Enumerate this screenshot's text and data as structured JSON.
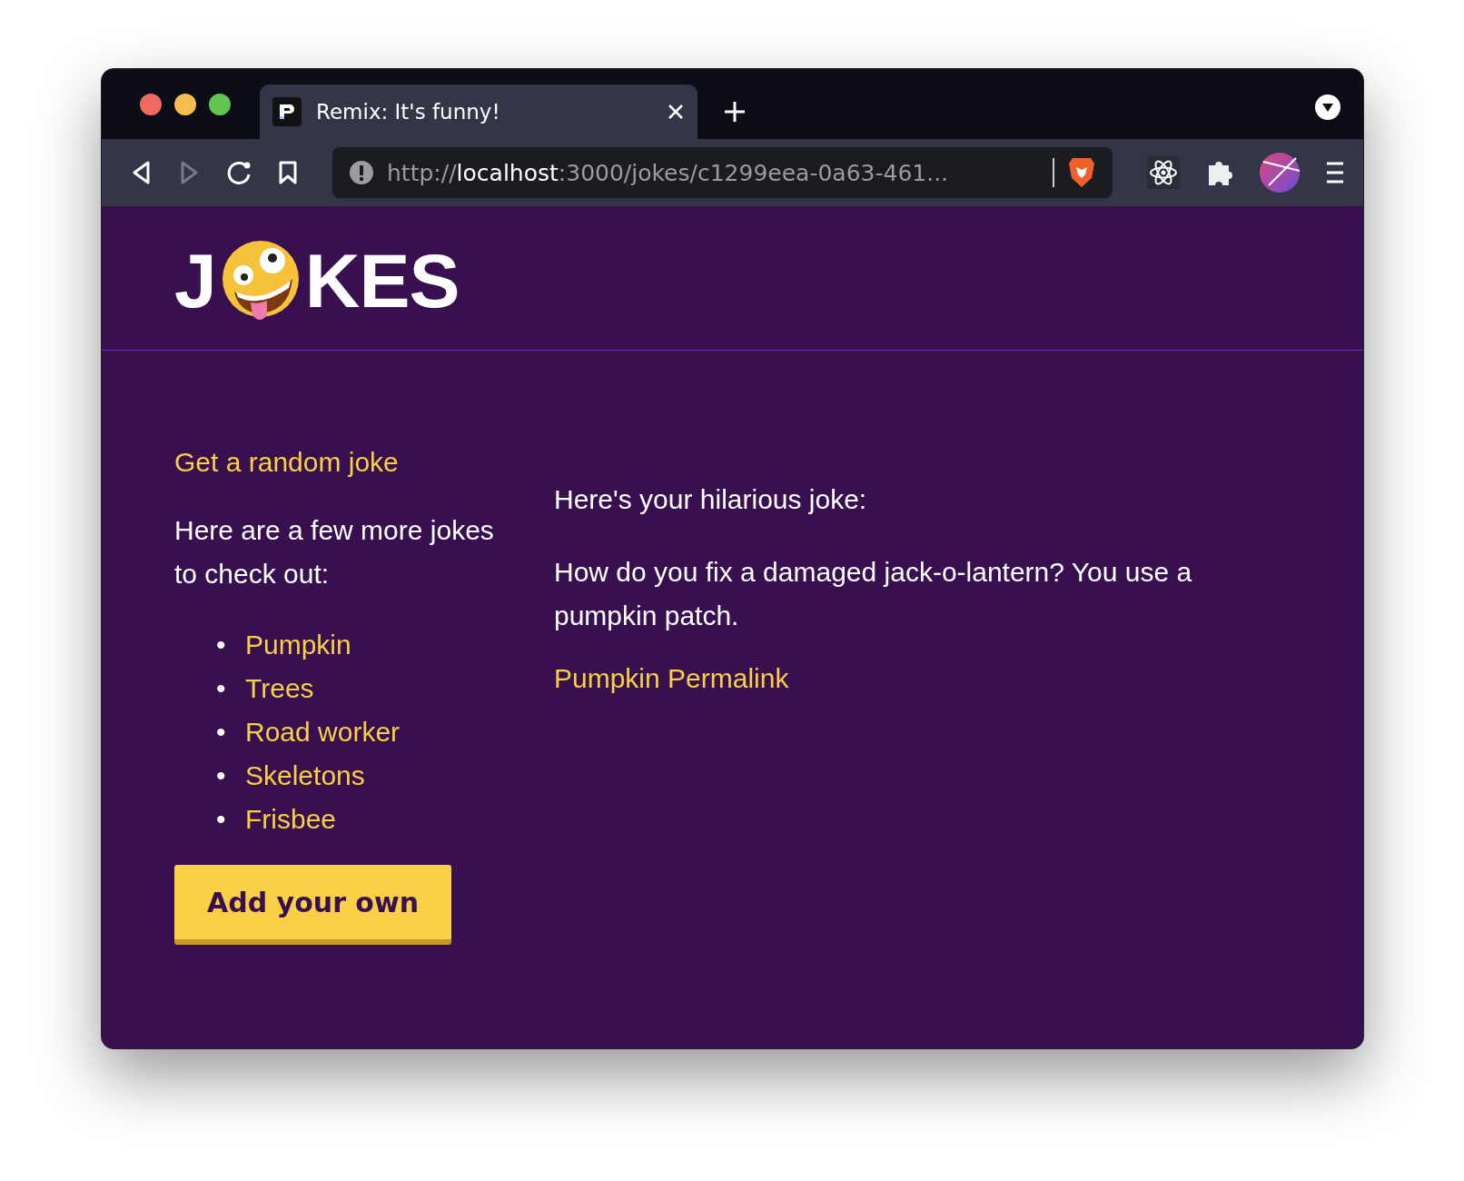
{
  "browser": {
    "tab": {
      "title": "Remix: It's funny!",
      "selected": true
    },
    "address": {
      "scheme": "http://",
      "host": "localhost",
      "rest": ":3000/jokes/c1299eea-0a63-461..."
    }
  },
  "logo": {
    "before": "J",
    "after": "KES"
  },
  "sidebar": {
    "random_link": "Get a random joke",
    "intro": "Here are a few more jokes to check out:",
    "jokes": [
      {
        "bullet": "•",
        "title": "Pumpkin"
      },
      {
        "bullet": "•",
        "title": "Trees"
      },
      {
        "bullet": "•",
        "title": "Road worker"
      },
      {
        "bullet": "•",
        "title": "Skeletons"
      },
      {
        "bullet": "•",
        "title": "Frisbee"
      }
    ],
    "add_button": "Add your own"
  },
  "joke": {
    "heading": "Here's your hilarious joke:",
    "content": "How do you fix a damaged jack-o-lantern? You use a pumpkin patch.",
    "permalink": "Pumpkin Permalink"
  }
}
